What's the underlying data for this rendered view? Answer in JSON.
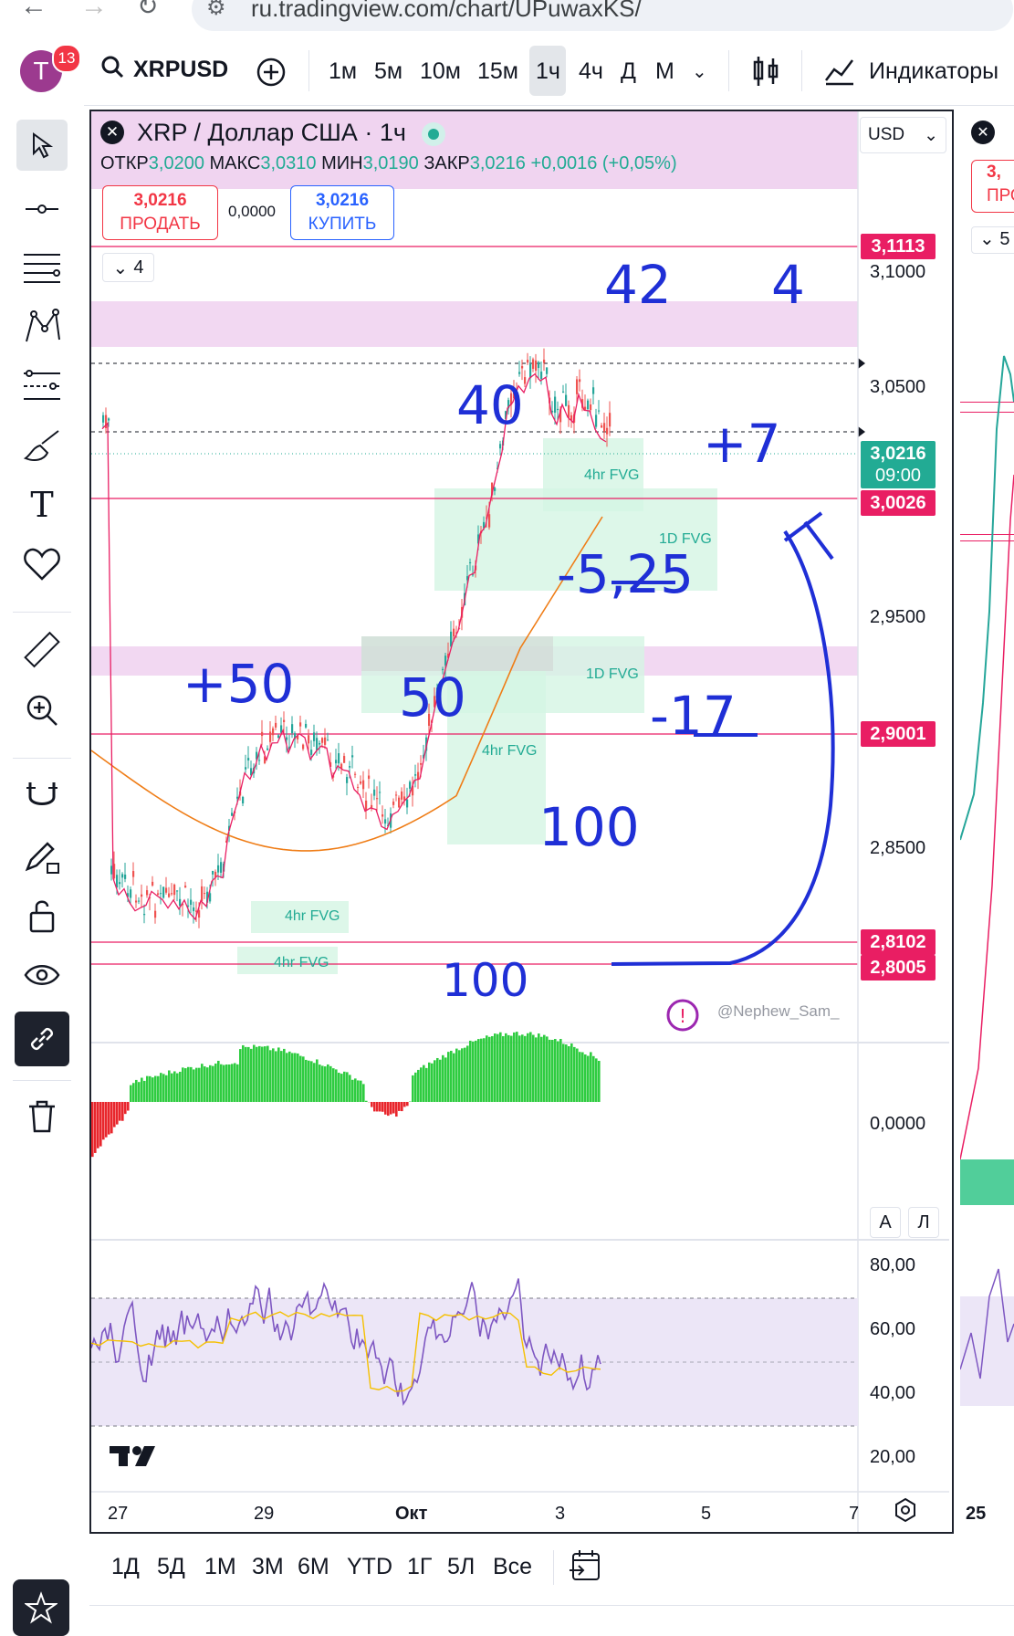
{
  "browser": {
    "url": "ru.tradingview.com/chart/UPuwaxKS/"
  },
  "header": {
    "avatar_letter": "T",
    "notification_count": "13",
    "symbol": "XRPUSD",
    "timeframes": [
      "1м",
      "5м",
      "10м",
      "15м",
      "1ч",
      "4ч",
      "Д",
      "М"
    ],
    "active_timeframe": "1ч",
    "indicators_label": "Индикаторы"
  },
  "legend": {
    "title": "XRP / Доллар США · 1ч",
    "open_label": "ОТКР",
    "open": "3,0200",
    "high_label": "МАКС",
    "high": "3,0310",
    "low_label": "МИН",
    "low": "3,0190",
    "close_label": "ЗАКР",
    "close": "3,0216",
    "change": "+0,0016 (+0,05%)",
    "sell_price": "3,0216",
    "sell_label": "ПРОДАТЬ",
    "spread": "0,0000",
    "buy_price": "3,0216",
    "buy_label": "КУПИТЬ",
    "indicators_count": "4"
  },
  "currency": "USD",
  "price_axis": {
    "ticks": [
      "3,1000",
      "3,0500",
      "2,9500",
      "2,8500"
    ],
    "labels": [
      {
        "value": "3,1113",
        "color": "#e91e63"
      },
      {
        "value": "3,0216",
        "sub": "09:00",
        "color": "#22ab94"
      },
      {
        "value": "3,0026",
        "color": "#e91e63"
      },
      {
        "value": "2,9001",
        "color": "#e91e63"
      },
      {
        "value": "2,8102",
        "color": "#e91e63"
      },
      {
        "value": "2,8005",
        "color": "#e91e63"
      }
    ],
    "osc_zero": "0,0000",
    "scale_buttons": [
      "A",
      "Л"
    ],
    "rsi_ticks": [
      "80,00",
      "60,00",
      "40,00",
      "20,00"
    ]
  },
  "time_axis": [
    "27",
    "29",
    "Окт",
    "3",
    "5",
    "7"
  ],
  "right_panel": {
    "time": "25",
    "price_prefix": "3,",
    "btn": "ПРО",
    "count": "5"
  },
  "annotations": {
    "fvg": [
      "4hr FVG",
      "1D FVG",
      "1D FVG",
      "4hr FVG",
      "4hr FVG",
      "4hr FVG"
    ],
    "handwritten": [
      "42",
      "4",
      "40",
      "+7",
      "-5,25",
      "+50",
      "50",
      "-17",
      "100",
      "100"
    ],
    "watermark": "@Nephew_Sam_"
  },
  "bottom_ranges": [
    "1Д",
    "5Д",
    "1М",
    "3М",
    "6М",
    "YTD",
    "1Г",
    "5Л",
    "Все"
  ],
  "colors": {
    "accent": "#2962ff",
    "up": "#26a69a",
    "down": "#ef5350",
    "level": "#e91e63",
    "ink": "#1f2fd6"
  }
}
